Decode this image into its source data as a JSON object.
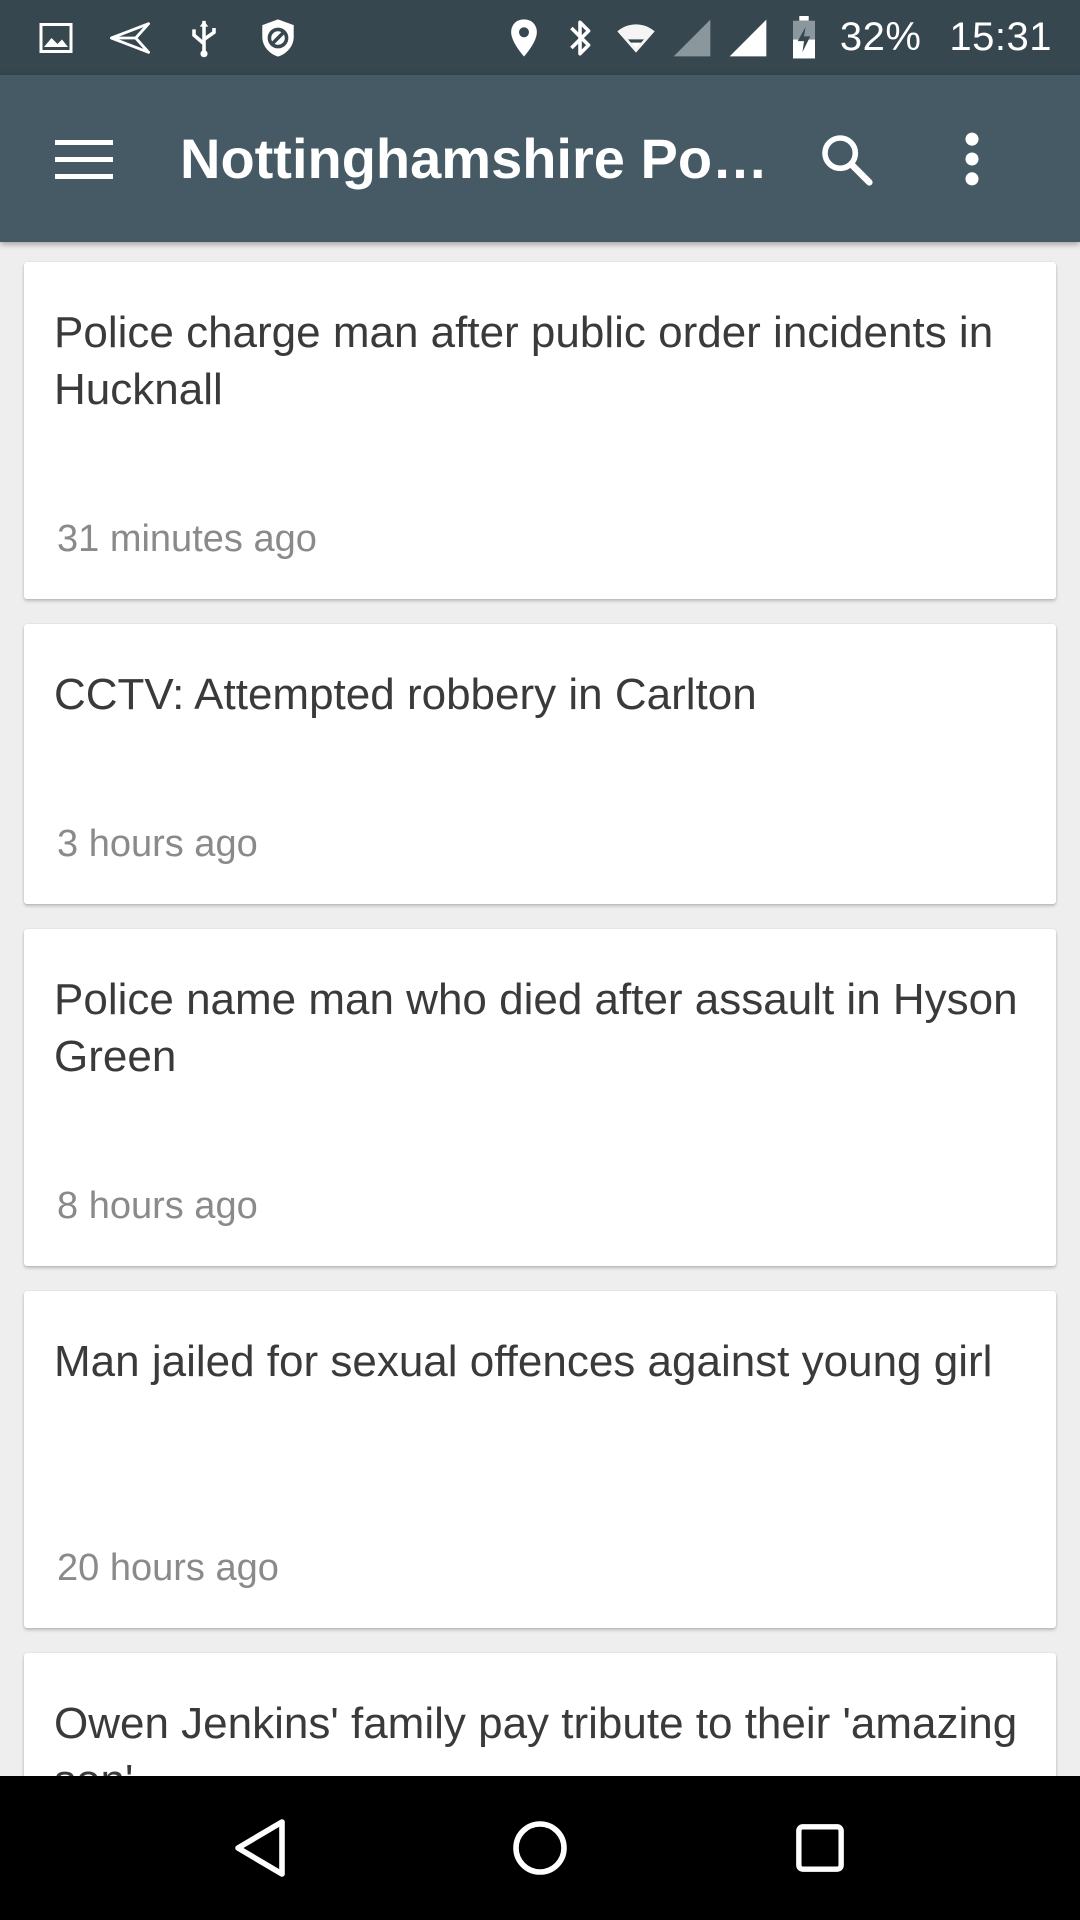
{
  "status_bar": {
    "battery_percent": "32%",
    "time": "15:31",
    "left_icons": [
      "image-icon",
      "send-icon",
      "usb-icon",
      "shield-icon"
    ],
    "right_icons": [
      "location-icon",
      "bluetooth-icon",
      "wifi-icon",
      "signal-icon",
      "battery-icon"
    ]
  },
  "app_bar": {
    "title": "Nottinghamshire Police News",
    "menu_icon": "menu-icon",
    "search_icon": "search-icon",
    "more_icon": "more-vert-icon",
    "color": "#455a64"
  },
  "articles": [
    {
      "title": "Police charge man after public order incidents in Hucknall",
      "time": "31 minutes ago"
    },
    {
      "title": "CCTV: Attempted robbery in Carlton",
      "time": "3 hours ago"
    },
    {
      "title": "Police name man who died after assault in Hyson Green",
      "time": "8 hours ago"
    },
    {
      "title": "Man jailed for sexual offences against young girl",
      "time": "20 hours ago"
    },
    {
      "title": "Owen Jenkins' family pay tribute to their 'amazing son'",
      "time": ""
    }
  ],
  "nav_bar": {
    "buttons": [
      "back-icon",
      "home-icon",
      "recents-icon"
    ]
  }
}
